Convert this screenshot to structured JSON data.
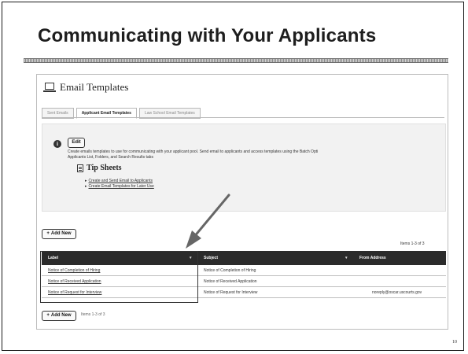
{
  "slide": {
    "title": "Communicating with Your Applicants",
    "page_number": "10"
  },
  "screenshot": {
    "title": "Email Templates",
    "tabs": [
      "Sent Emails",
      "Applicant Email Templates",
      "Law School Email Templates"
    ],
    "active_tab": "Applicant Email Templates",
    "edit_label": "Edit",
    "info_text": "Create emails templates to use for communicating with your applicant pool. Send email to applicants and access templates using the Batch Opti\nApplicants List, Folders, and Search Results tabs",
    "tip_title": "Tip Sheets",
    "tip_links": [
      "Create and Send Email to Applicants",
      "Create Email Templates for Later Use"
    ],
    "add_new_label": "Add New",
    "items_top": "Items 1-3 of 3",
    "items_bottom": "Items 1-3 of 3",
    "columns": [
      "Label",
      "Subject",
      "From Address"
    ],
    "rows": [
      {
        "label": "Notice of Completion of Hiring",
        "subject": "Notice of Completion of Hiring",
        "from": ""
      },
      {
        "label": "Notice of Received Application",
        "subject": "Notice of Received Application",
        "from": ""
      },
      {
        "label": "Notice of Request for Interview",
        "subject": "Notice of Request for Interview",
        "from": "noreply@oscar.uscourts.gov"
      }
    ]
  },
  "colors": {
    "header_bg": "#2b2b2b",
    "panel_bg": "#f2f2f2",
    "arrow": "#666666"
  }
}
